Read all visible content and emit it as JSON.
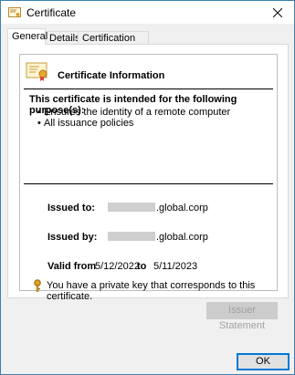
{
  "window": {
    "title": "Certificate"
  },
  "tabs": [
    {
      "label": "General",
      "active": true
    },
    {
      "label": "Details",
      "active": false
    },
    {
      "label": "Certification Path",
      "active": false
    }
  ],
  "info": {
    "title": "Certificate Information",
    "purpose_heading": "This certificate is intended for the following purpose(s):",
    "purposes": [
      "Ensures the identity of a remote computer",
      "All issuance policies"
    ],
    "issued_to_label": "Issued to:",
    "issued_to_value": ".global.corp",
    "issued_by_label": "Issued by:",
    "issued_by_value": ".global.corp",
    "valid_from_label": "Valid from",
    "valid_from": "5/12/2022",
    "to_label": "to",
    "valid_to": "5/11/2023",
    "private_key_note": "You have a private key that corresponds to this certificate."
  },
  "buttons": {
    "issuer_statement": "Issuer Statement",
    "ok": "OK"
  }
}
